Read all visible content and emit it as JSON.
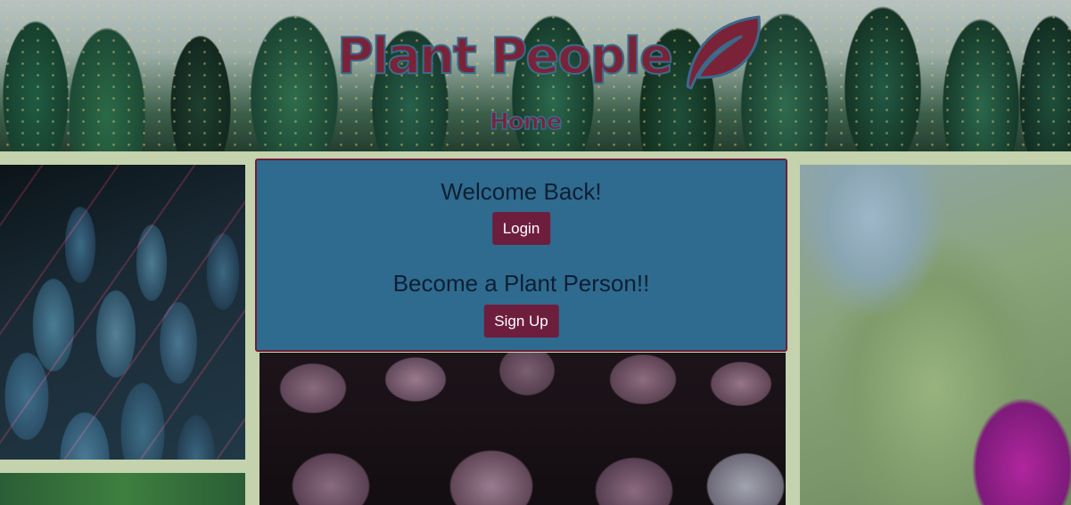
{
  "header": {
    "logo_text": "Plant People",
    "nav_home": "Home"
  },
  "card": {
    "welcome_heading": "Welcome Back!",
    "login_label": "Login",
    "become_heading": "Become a Plant Person!!",
    "signup_label": "Sign Up"
  },
  "colors": {
    "page_background": "#c4d2ad",
    "card_background": "#2f6b8f",
    "button_background": "#6e1e3d",
    "brand_logo": "#7a2338"
  },
  "images": [
    "cactus-banner",
    "blue-red-succulent",
    "green-foliage",
    "purple-succulents",
    "purple-tulip"
  ]
}
